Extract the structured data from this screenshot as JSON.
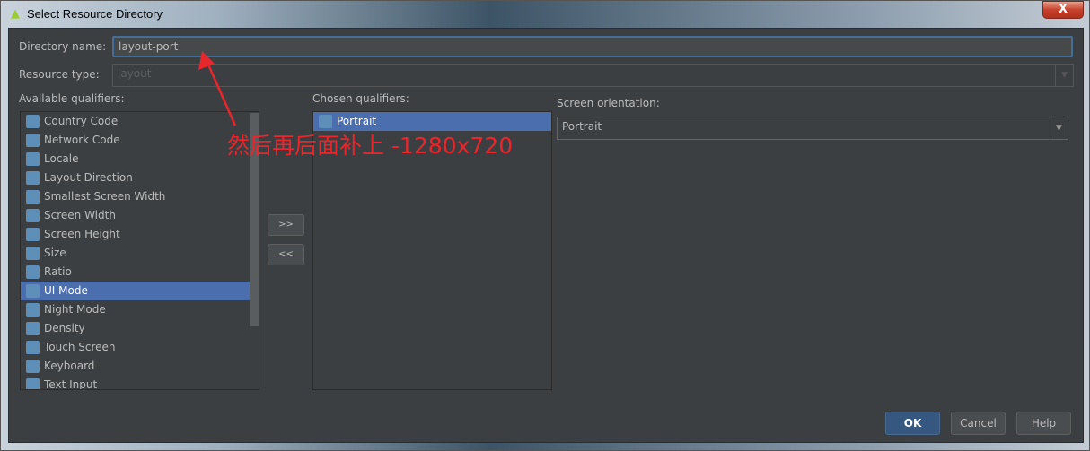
{
  "window": {
    "title": "Select Resource Directory",
    "close_label": "X"
  },
  "form": {
    "directory_name_label": "Directory name:",
    "directory_name_value": "layout-port",
    "resource_type_label": "Resource type:",
    "resource_type_value": "layout",
    "available_label": "Available qualifiers:",
    "chosen_label": "Chosen qualifiers:",
    "orientation_label": "Screen orientation:",
    "orientation_value": "Portrait"
  },
  "available": [
    {
      "label": "Country Code",
      "icon": "globe-sim-icon"
    },
    {
      "label": "Network Code",
      "icon": "network-icon"
    },
    {
      "label": "Locale",
      "icon": "globe-icon"
    },
    {
      "label": "Layout Direction",
      "icon": "layout-direction-icon"
    },
    {
      "label": "Smallest Screen Width",
      "icon": "smallest-width-icon"
    },
    {
      "label": "Screen Width",
      "icon": "width-icon"
    },
    {
      "label": "Screen Height",
      "icon": "height-icon"
    },
    {
      "label": "Size",
      "icon": "size-icon"
    },
    {
      "label": "Ratio",
      "icon": "ratio-icon"
    },
    {
      "label": "UI Mode",
      "icon": "ui-mode-icon",
      "selected": true
    },
    {
      "label": "Night Mode",
      "icon": "night-mode-icon"
    },
    {
      "label": "Density",
      "icon": "density-icon"
    },
    {
      "label": "Touch Screen",
      "icon": "touch-icon"
    },
    {
      "label": "Keyboard",
      "icon": "keyboard-icon"
    },
    {
      "label": "Text Input",
      "icon": "text-input-icon"
    }
  ],
  "chosen": [
    {
      "label": "Portrait",
      "icon": "portrait-icon",
      "selected": true
    }
  ],
  "buttons": {
    "add": ">>",
    "remove": "<<",
    "ok": "OK",
    "cancel": "Cancel",
    "help": "Help"
  },
  "annotation": {
    "text": "然后再后面补上 -1280x720",
    "color": "#e8262b"
  }
}
